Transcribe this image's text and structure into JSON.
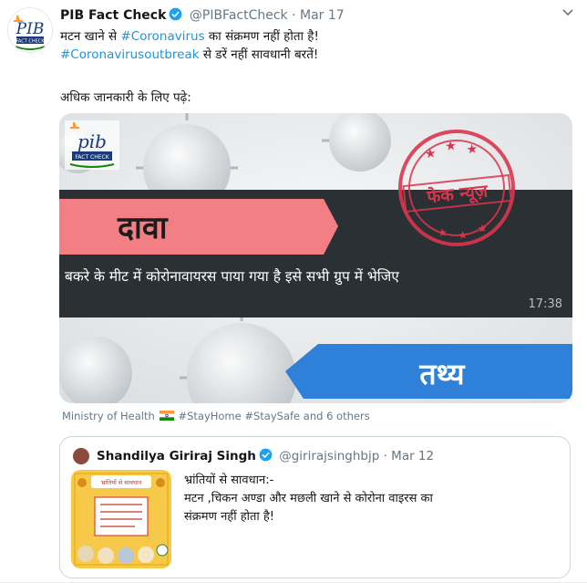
{
  "tweet": {
    "author_name": "PIB Fact Check",
    "handle": "@PIBFactCheck",
    "separator": "·",
    "date": "Mar 17",
    "text_line1_prefix": "मटन खाने से ",
    "text_line1_tag": "#Coronavirus",
    "text_line1_suffix": " का संक्रमण नहीं होता है!",
    "text_line2_tag": "#Coronavirusoutbreak",
    "text_line2_suffix": " से डरें नहीं सावधानी बरतें!",
    "more_info": "अधिक जानकारी के लिए पढ़े:",
    "avatar_text": "PIB",
    "avatar_subtext": "FACT CHECK"
  },
  "card": {
    "logo_text": "pib",
    "logo_subtext": "FACT CHECK",
    "claim_label": "दावा",
    "claim_text": "बकरे के मीट में कोरोनावायरस पाया गया है इसे सभी ग्रुप में भेजिए",
    "timestamp": "17:38",
    "stamp_text": "फेक न्यूज़",
    "fact_label": "तथ्य"
  },
  "credits": {
    "org": "Ministry of Health",
    "tags": "#StayHome #StaySafe and 6 others"
  },
  "quoted": {
    "author_name": "Shandilya Giriraj Singh",
    "handle": "@girirajsinghbjp",
    "separator": "·",
    "date": "Mar 12",
    "line1": "भ्रांतियों से सावधान:-",
    "line2": "मटन ,चिकन अण्डा और मछली खाने से कोरोना वाइरस का",
    "line3": "संक्रमण नहीं होता है!",
    "thumb_title": "भ्रांतियों से सावधान"
  },
  "colors": {
    "link": "#1b95e0",
    "verified": "#1da1f2",
    "claim_pink": "#f27f84",
    "fact_blue": "#2f80d8",
    "stamp_red": "#d9354c"
  }
}
